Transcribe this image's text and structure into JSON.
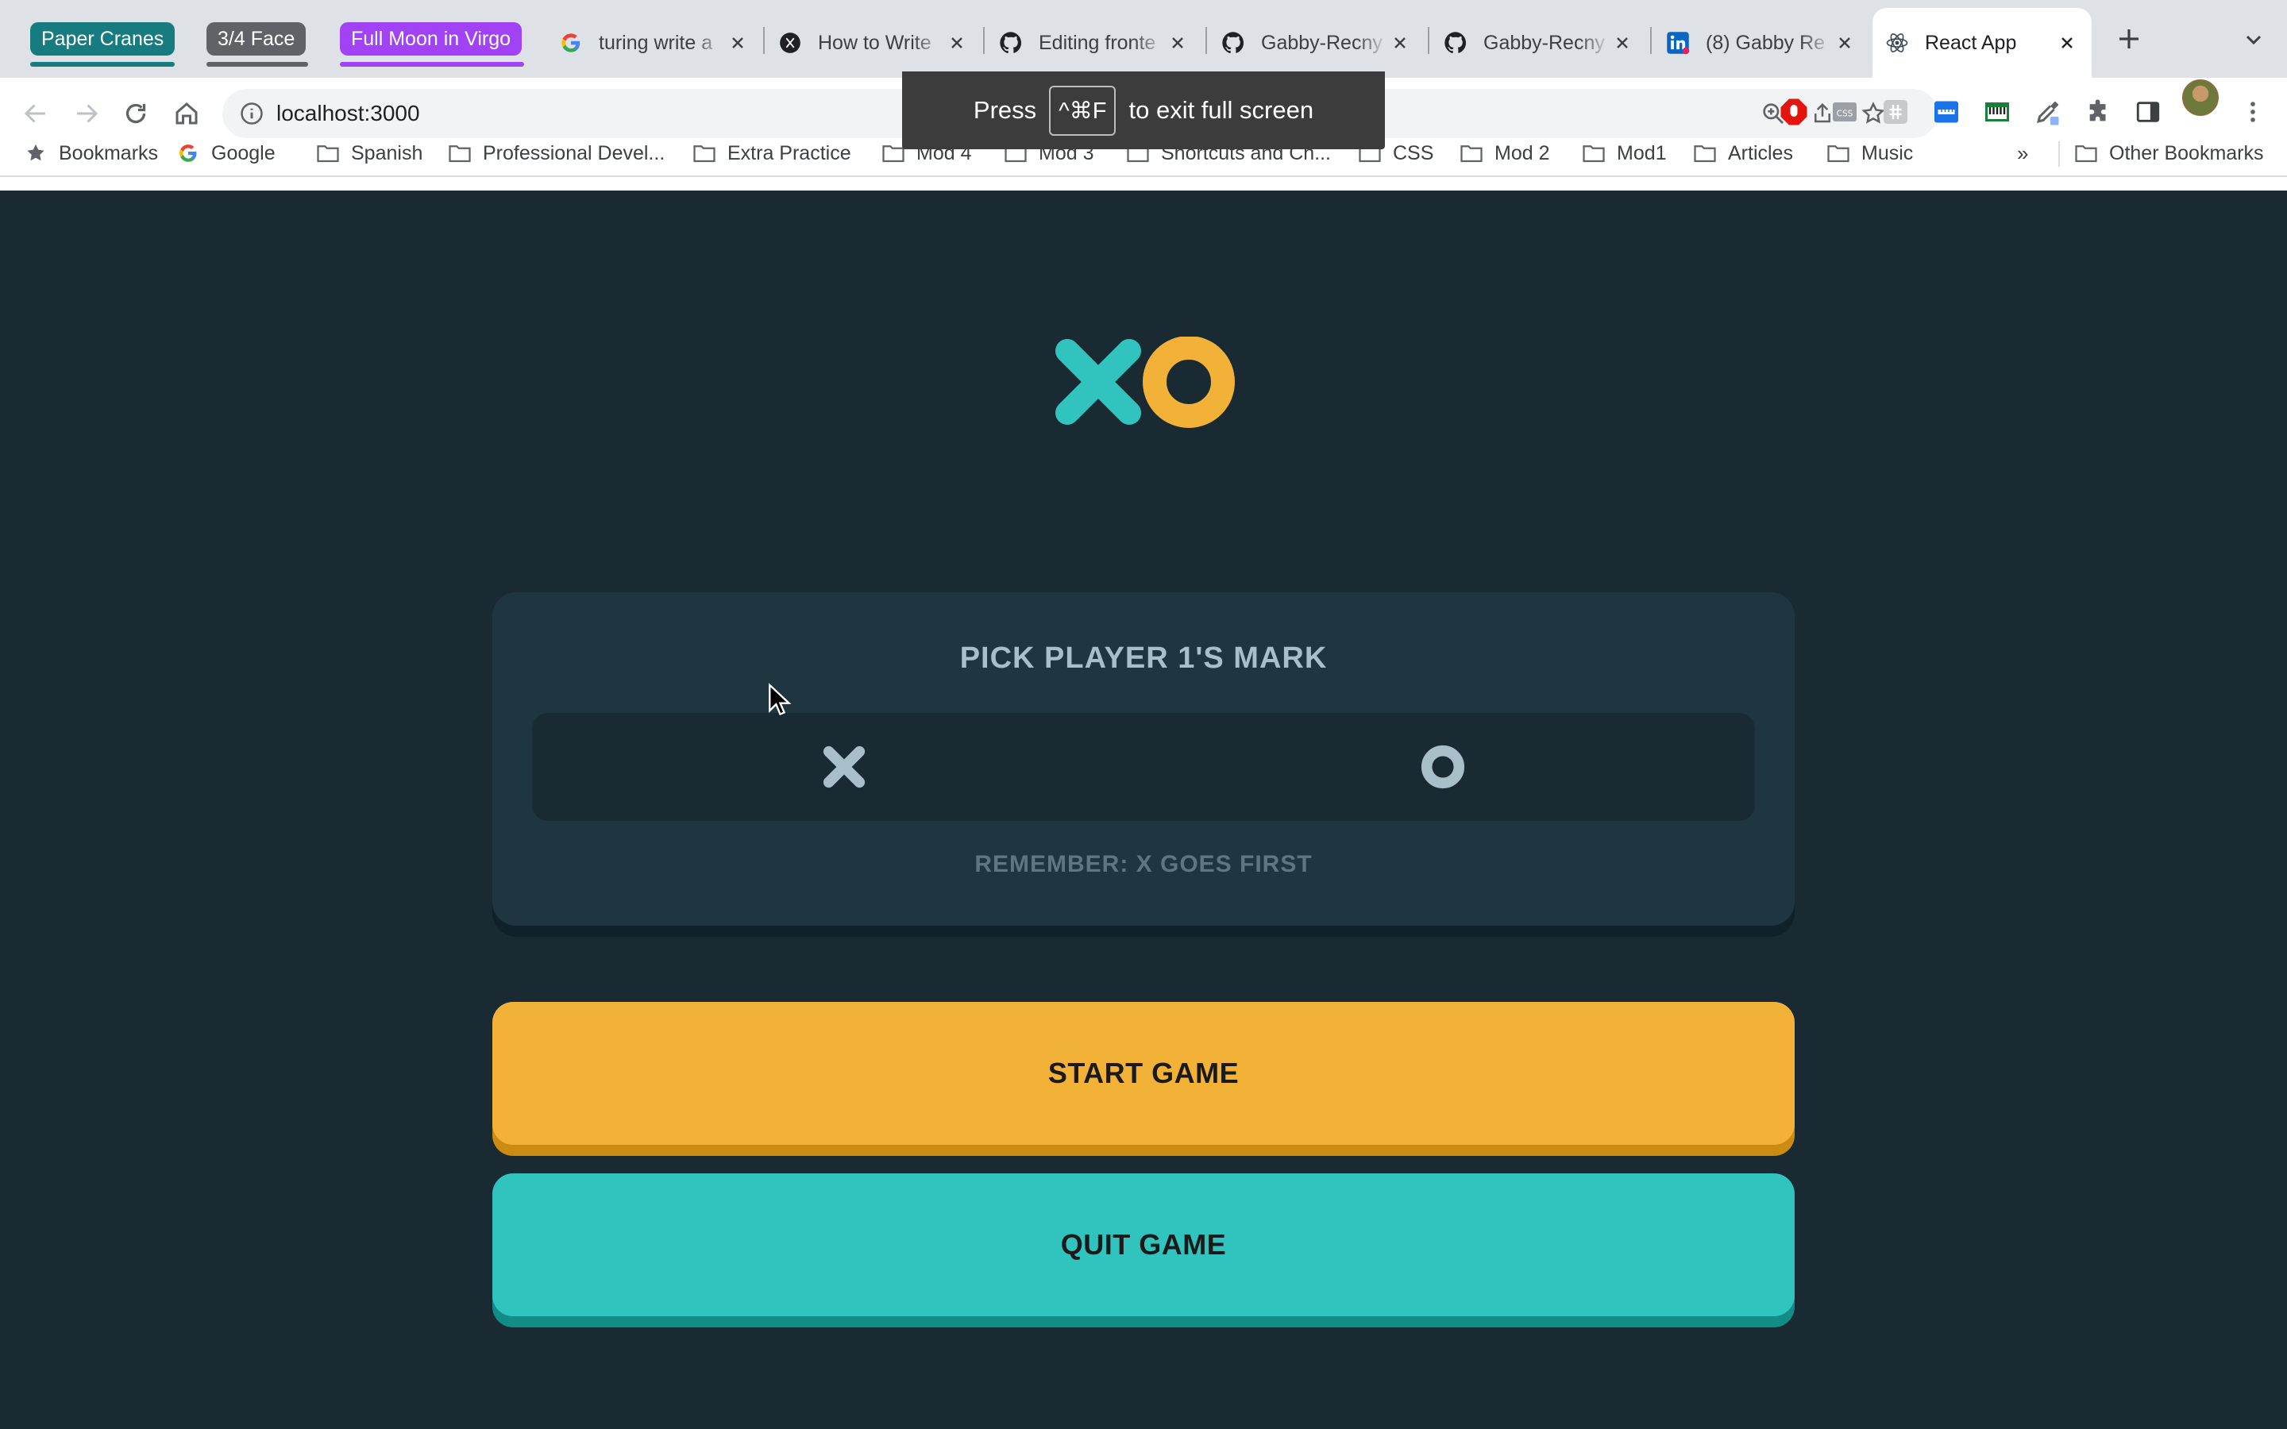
{
  "browser": {
    "tab_groups": [
      {
        "label": "Paper Cranes",
        "color": "#167c80"
      },
      {
        "label": "3/4 Face",
        "color": "#5f6368"
      },
      {
        "label": "Full Moon in Virgo",
        "color": "#a142f4"
      }
    ],
    "tabs": [
      {
        "title": "turing write a",
        "icon": "google-icon"
      },
      {
        "title": "How to Write",
        "icon": "dev-icon"
      },
      {
        "title": "Editing fronte",
        "icon": "github-icon"
      },
      {
        "title": "Gabby-Recny",
        "icon": "github-icon"
      },
      {
        "title": "Gabby-Recny",
        "icon": "github-icon"
      },
      {
        "title": "(8) Gabby Re",
        "icon": "linkedin-icon"
      },
      {
        "title": "React App",
        "icon": "react-icon",
        "active": true
      }
    ],
    "url": "localhost:3000",
    "bookmarks": [
      {
        "label": "Bookmarks",
        "icon": "star-icon"
      },
      {
        "label": "Google",
        "icon": "google-icon"
      },
      {
        "label": "Spanish",
        "icon": "folder-icon"
      },
      {
        "label": "Professional Devel...",
        "icon": "folder-icon"
      },
      {
        "label": "Extra Practice",
        "icon": "folder-icon"
      },
      {
        "label": "Mod 4",
        "icon": "folder-icon"
      },
      {
        "label": "Mod 3",
        "icon": "folder-icon"
      },
      {
        "label": "Shortcuts and Ch...",
        "icon": "folder-icon"
      },
      {
        "label": "CSS",
        "icon": "folder-icon"
      },
      {
        "label": "Mod 2",
        "icon": "folder-icon"
      },
      {
        "label": "Mod1",
        "icon": "folder-icon"
      },
      {
        "label": "Articles",
        "icon": "folder-icon"
      },
      {
        "label": "Music",
        "icon": "folder-icon"
      }
    ],
    "bookmarks_overflow": "»",
    "other_bookmarks": "Other Bookmarks",
    "fullscreen_toast": {
      "prefix": "Press",
      "key": "^⌘F",
      "suffix": "to exit full screen"
    }
  },
  "game": {
    "logo_icons": [
      "x-mark-icon",
      "o-mark-icon"
    ],
    "pick_title": "PICK PLAYER 1'S MARK",
    "mark_options": [
      "X",
      "O"
    ],
    "hint": "REMEMBER: X GOES FIRST",
    "start_label": "START GAME",
    "quit_label": "QUIT GAME"
  },
  "colors": {
    "background": "#1a2a33",
    "card": "#1f3641",
    "teal": "#31c3bd",
    "yellow": "#f2b137",
    "silver": "#a8bfc9"
  }
}
